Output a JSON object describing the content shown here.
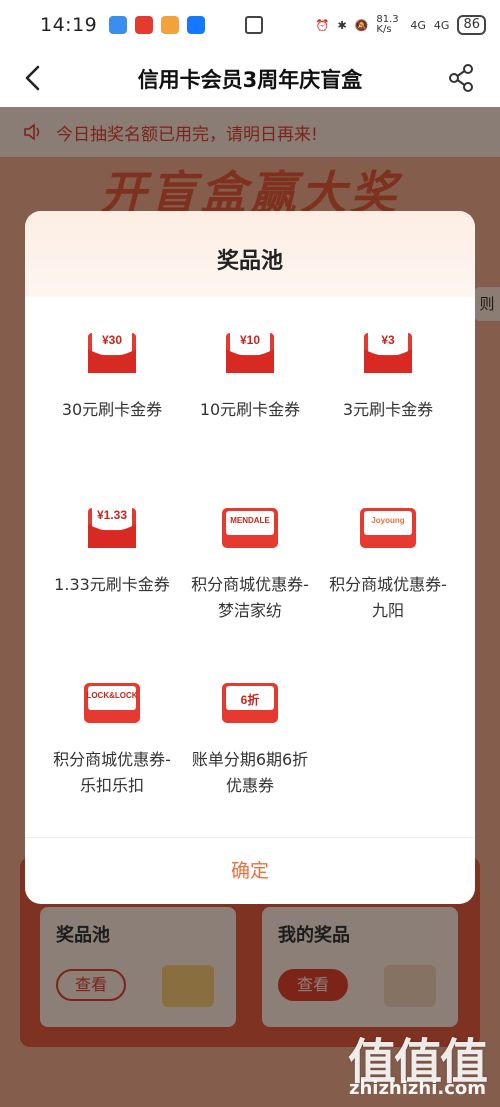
{
  "status_bar": {
    "time": "14:19",
    "net_speed": "81.3 K/s",
    "signal1": "4G",
    "signal2": "4G",
    "battery": "86"
  },
  "header": {
    "title": "信用卡会员3周年庆盲盒"
  },
  "notice": {
    "text": "今日抽奖名额已用完，请明日再来!"
  },
  "hero_text": "开盲盒赢大奖",
  "rule_tab": "则",
  "bottom": {
    "left_card": {
      "title": "奖品池",
      "button": "查看"
    },
    "right_card": {
      "title": "我的奖品",
      "button": "查看"
    }
  },
  "modal": {
    "title": "奖品池",
    "confirm": "确定",
    "prizes": [
      {
        "label": "30元刷卡金券",
        "badge": "¥30",
        "icon": "red-envelope-icon",
        "color": "#e6392f"
      },
      {
        "label": "10元刷卡金券",
        "badge": "¥10",
        "icon": "red-envelope-icon",
        "color": "#e6392f"
      },
      {
        "label": "3元刷卡金券",
        "badge": "¥3",
        "icon": "red-envelope-icon",
        "color": "#e6392f"
      },
      {
        "label": "1.33元刷卡金券",
        "badge": "¥1.33",
        "icon": "red-envelope-icon",
        "color": "#e6392f"
      },
      {
        "label": "积分商城优惠券-梦洁家纺",
        "badge": "MENDALE",
        "icon": "coupon-mendale-icon",
        "color": "#e6392f"
      },
      {
        "label": "积分商城优惠券-九阳",
        "badge": "Joyoung",
        "icon": "coupon-joyoung-icon",
        "color": "#e6392f"
      },
      {
        "label": "积分商城优惠券-乐扣乐扣",
        "badge": "LOCK&LOCK",
        "icon": "coupon-locklock-icon",
        "color": "#e6392f"
      },
      {
        "label": "账单分期6期6折优惠券",
        "badge": "6折",
        "icon": "coupon-discount-icon",
        "color": "#e6392f"
      }
    ]
  },
  "watermark": {
    "main": "值值值",
    "sub": "zhizhizhi.com"
  }
}
